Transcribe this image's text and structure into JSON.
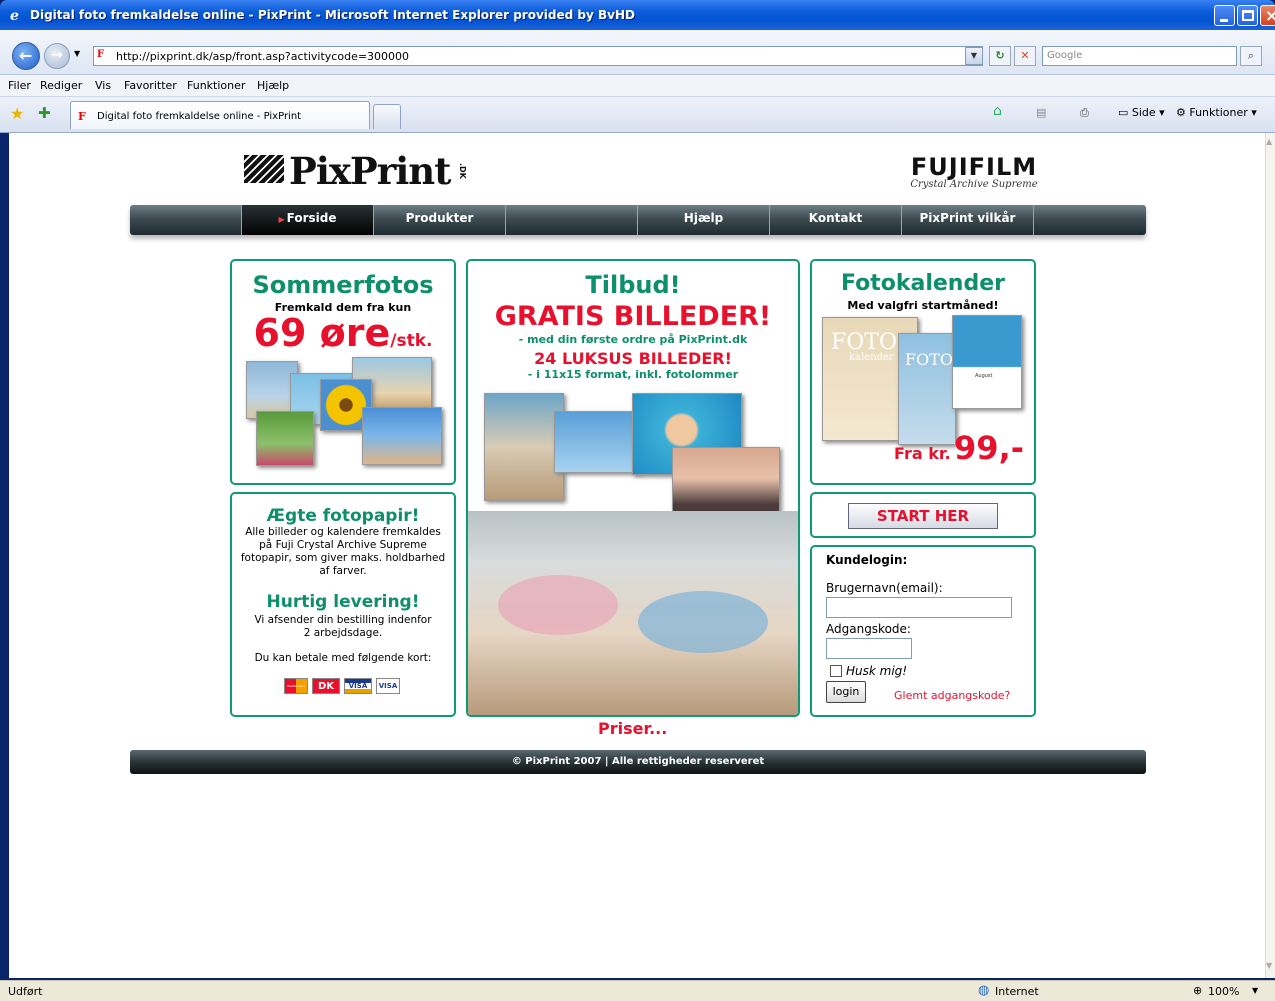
{
  "window": {
    "title": "Digital foto fremkaldelse online - PixPrint - Microsoft Internet Explorer provided by BvHD"
  },
  "addressbar": {
    "url": "http://pixprint.dk/asp/front.asp?activitycode=300000",
    "search_placeholder": "Google"
  },
  "menu": {
    "items": [
      "Filer",
      "Rediger",
      "Vis",
      "Favoritter",
      "Funktioner",
      "Hjælp"
    ]
  },
  "tabs": {
    "active": "Digital foto fremkaldelse online - PixPrint"
  },
  "toolbar": {
    "page": "Side",
    "tools": "Funktioner"
  },
  "site": {
    "logo_text": "PixPrint",
    "logo_tld": ".DK",
    "brand": "FUJIFILM",
    "brand_sub": "Crystal Archive Supreme",
    "nav": [
      "Forside",
      "Produkter",
      "",
      "Hjælp",
      "Kontakt",
      "PixPrint vilkår"
    ],
    "summer": {
      "title": "Sommerfotos",
      "sub": "Fremkald dem fra kun",
      "price": "69 øre",
      "unit": "/stk."
    },
    "offer": {
      "title": "Tilbud!",
      "headline": "GRATIS BILLEDER!",
      "sub": "- med din første ordre på PixPrint.dk",
      "headline2": "24 LUKSUS BILLEDER!",
      "sub2": "- i 11x15 format, inkl. fotolommer"
    },
    "calendar": {
      "title": "Fotokalender",
      "sub": "Med valgfri startmåned!",
      "price_prefix": "Fra kr.",
      "price": "99,-",
      "thumb1": "FOTO",
      "thumb1b": "kalender",
      "thumb2": "FOTO",
      "month": "August"
    },
    "start_button": "START HER",
    "paper": {
      "title": "Ægte fotopapir!",
      "text": "Alle billeder og kalendere fremkaldes på Fuji Crystal Archive Supreme fotopapir, som giver maks. holdbarhed af farver.",
      "title2": "Hurtig levering!",
      "text2": "Vi afsender din bestilling indenfor 2 arbejdsdage.",
      "pay_text": "Du kan betale med følgende kort:",
      "cards": [
        "MasterCard",
        "DK",
        "VISA",
        "VISA"
      ]
    },
    "login": {
      "title": "Kundelogin:",
      "user_label": "Brugernavn(email):",
      "pass_label": "Adgangskode:",
      "remember": "Husk mig!",
      "button": "login",
      "forgot": "Glemt adgangskode?"
    },
    "prices_link": "Priser...",
    "footer": "© PixPrint 2007  |  Alle rettigheder reserveret"
  },
  "status": {
    "left": "Udført",
    "zone": "Internet",
    "zoom": "100%"
  }
}
